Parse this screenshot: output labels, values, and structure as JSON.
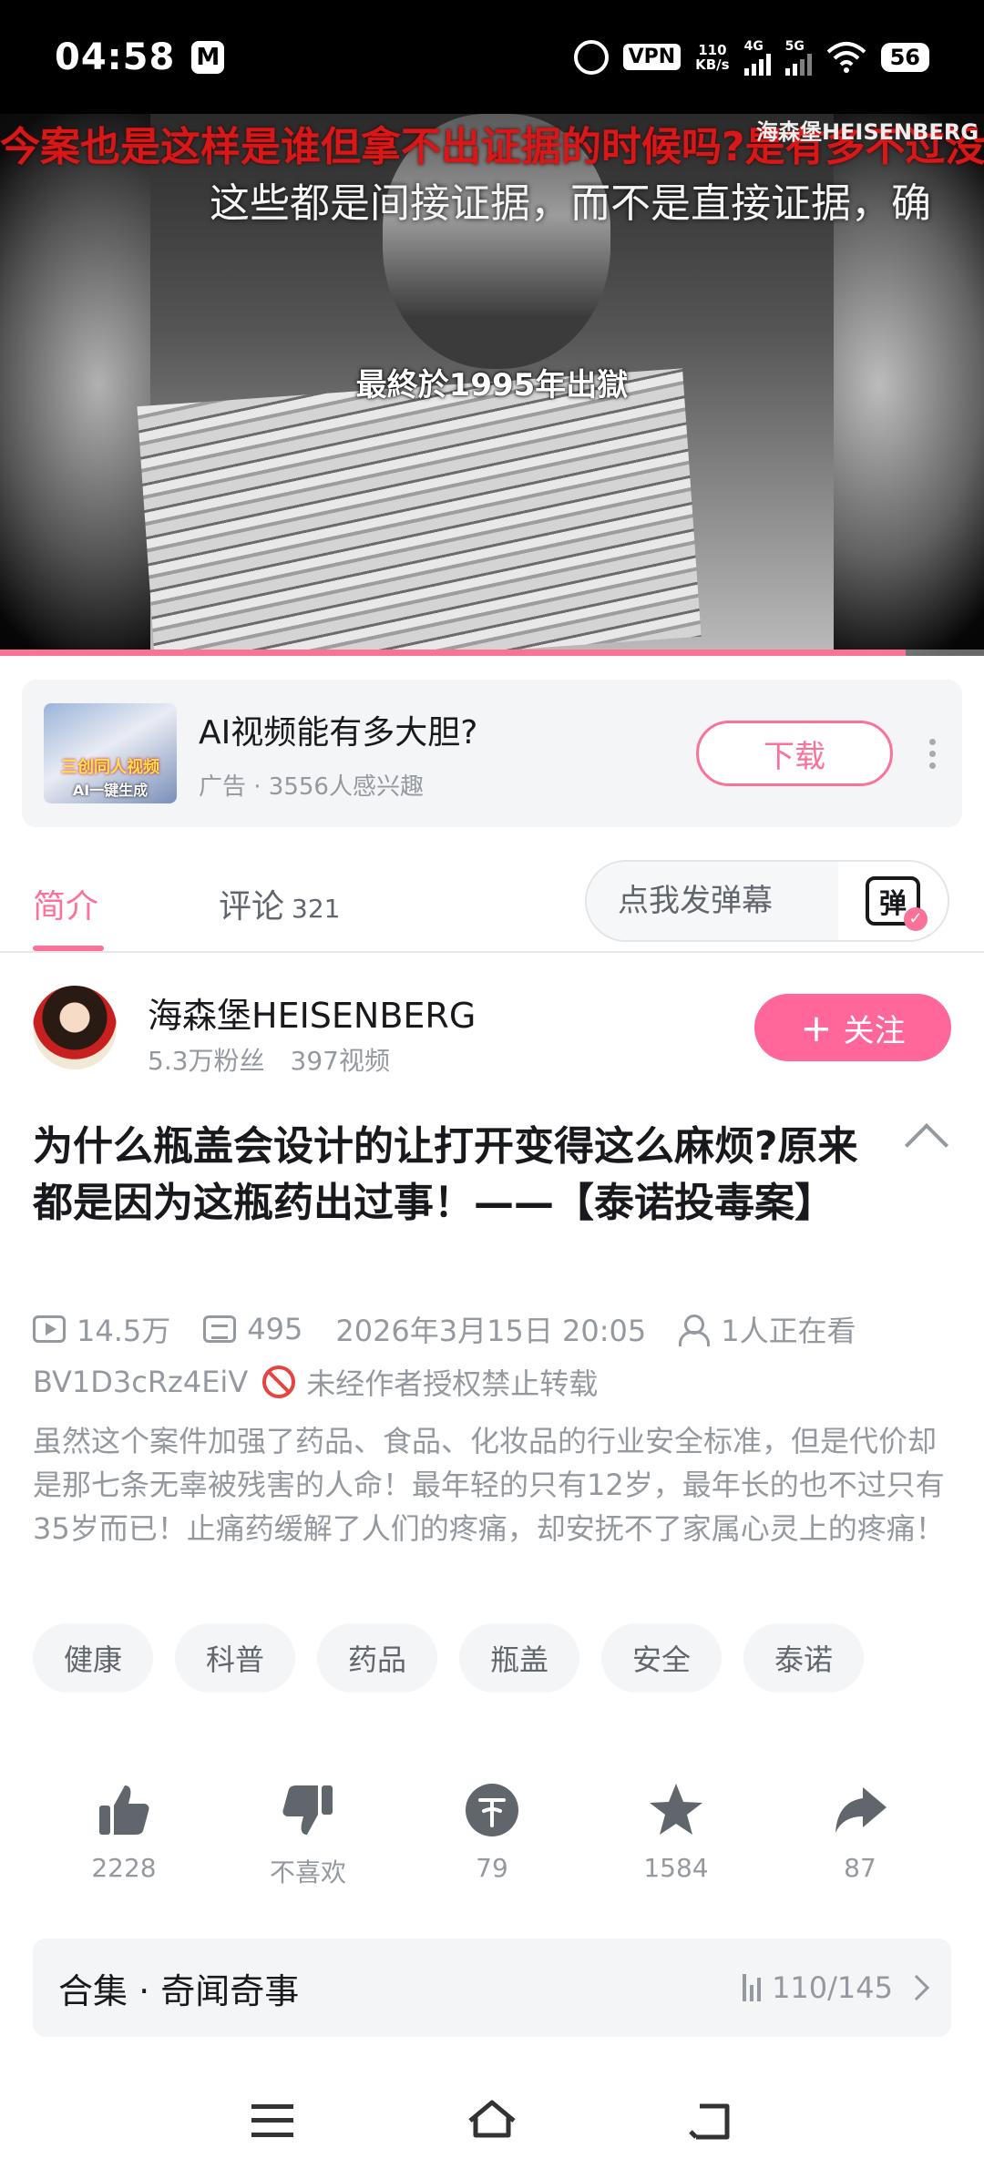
{
  "status_bar": {
    "time": "04:58",
    "mail_icon": "M",
    "vpn": "VPN",
    "speed_value": "110",
    "speed_unit": "KB/s",
    "net1": "4G",
    "net2": "5G",
    "battery": "56"
  },
  "video": {
    "danmaku_top": "今案也是这样是谁但拿不出证据的时候吗?是有多不过没",
    "watermark": "海森堡HEISENBERG",
    "subtitle": "这些都是间接证据，而不是直接证据，确",
    "caption": "最終於1995年出獄",
    "progress_fraction": 0.92
  },
  "ad": {
    "thumb_text_1": "三创同人视频",
    "thumb_text_2": "AI一键生成",
    "title": "AI视频能有多大胆?",
    "subtitle": "广告 · 3556人感兴趣",
    "button": "下载"
  },
  "tabs": {
    "intro": "简介",
    "comments": "评论",
    "comments_count": "321",
    "danmaku_placeholder": "点我发弹幕",
    "danmaku_toggle": "弹"
  },
  "uploader": {
    "name": "海森堡HEISENBERG",
    "fans": "5.3万粉丝",
    "videos": "397视频",
    "follow_plus": "+",
    "follow": "关注"
  },
  "video_info": {
    "title": "为什么瓶盖会设计的让打开变得这么麻烦?原来都是因为这瓶药出过事！——【泰诺投毒案】",
    "views": "14.5万",
    "danmaku_count": "495",
    "date": "2026年3月15日 20:05",
    "watching": "1人正在看",
    "bvid": "BV1D3cRz4EiV",
    "copyright": "未经作者授权禁止转载",
    "description": "虽然这个案件加强了药品、食品、化妆品的行业安全标准，但是代价却是那七条无辜被残害的人命！最年轻的只有12岁，最年长的也不过只有35岁而已！止痛药缓解了人们的疼痛，却安抚不了家属心灵上的疼痛！"
  },
  "tags": [
    "健康",
    "科普",
    "药品",
    "瓶盖",
    "安全",
    "泰诺"
  ],
  "actions": {
    "like": "2228",
    "dislike": "不喜欢",
    "coin": "79",
    "favorite": "1584",
    "share": "87"
  },
  "collection": {
    "title": "合集 · 奇闻奇事",
    "progress": "110/145"
  },
  "colors": {
    "accent": "#fb7299",
    "follow": "#ff6699",
    "text_primary": "#18191c",
    "text_secondary": "#9499a0",
    "danger": "#e8433f"
  }
}
